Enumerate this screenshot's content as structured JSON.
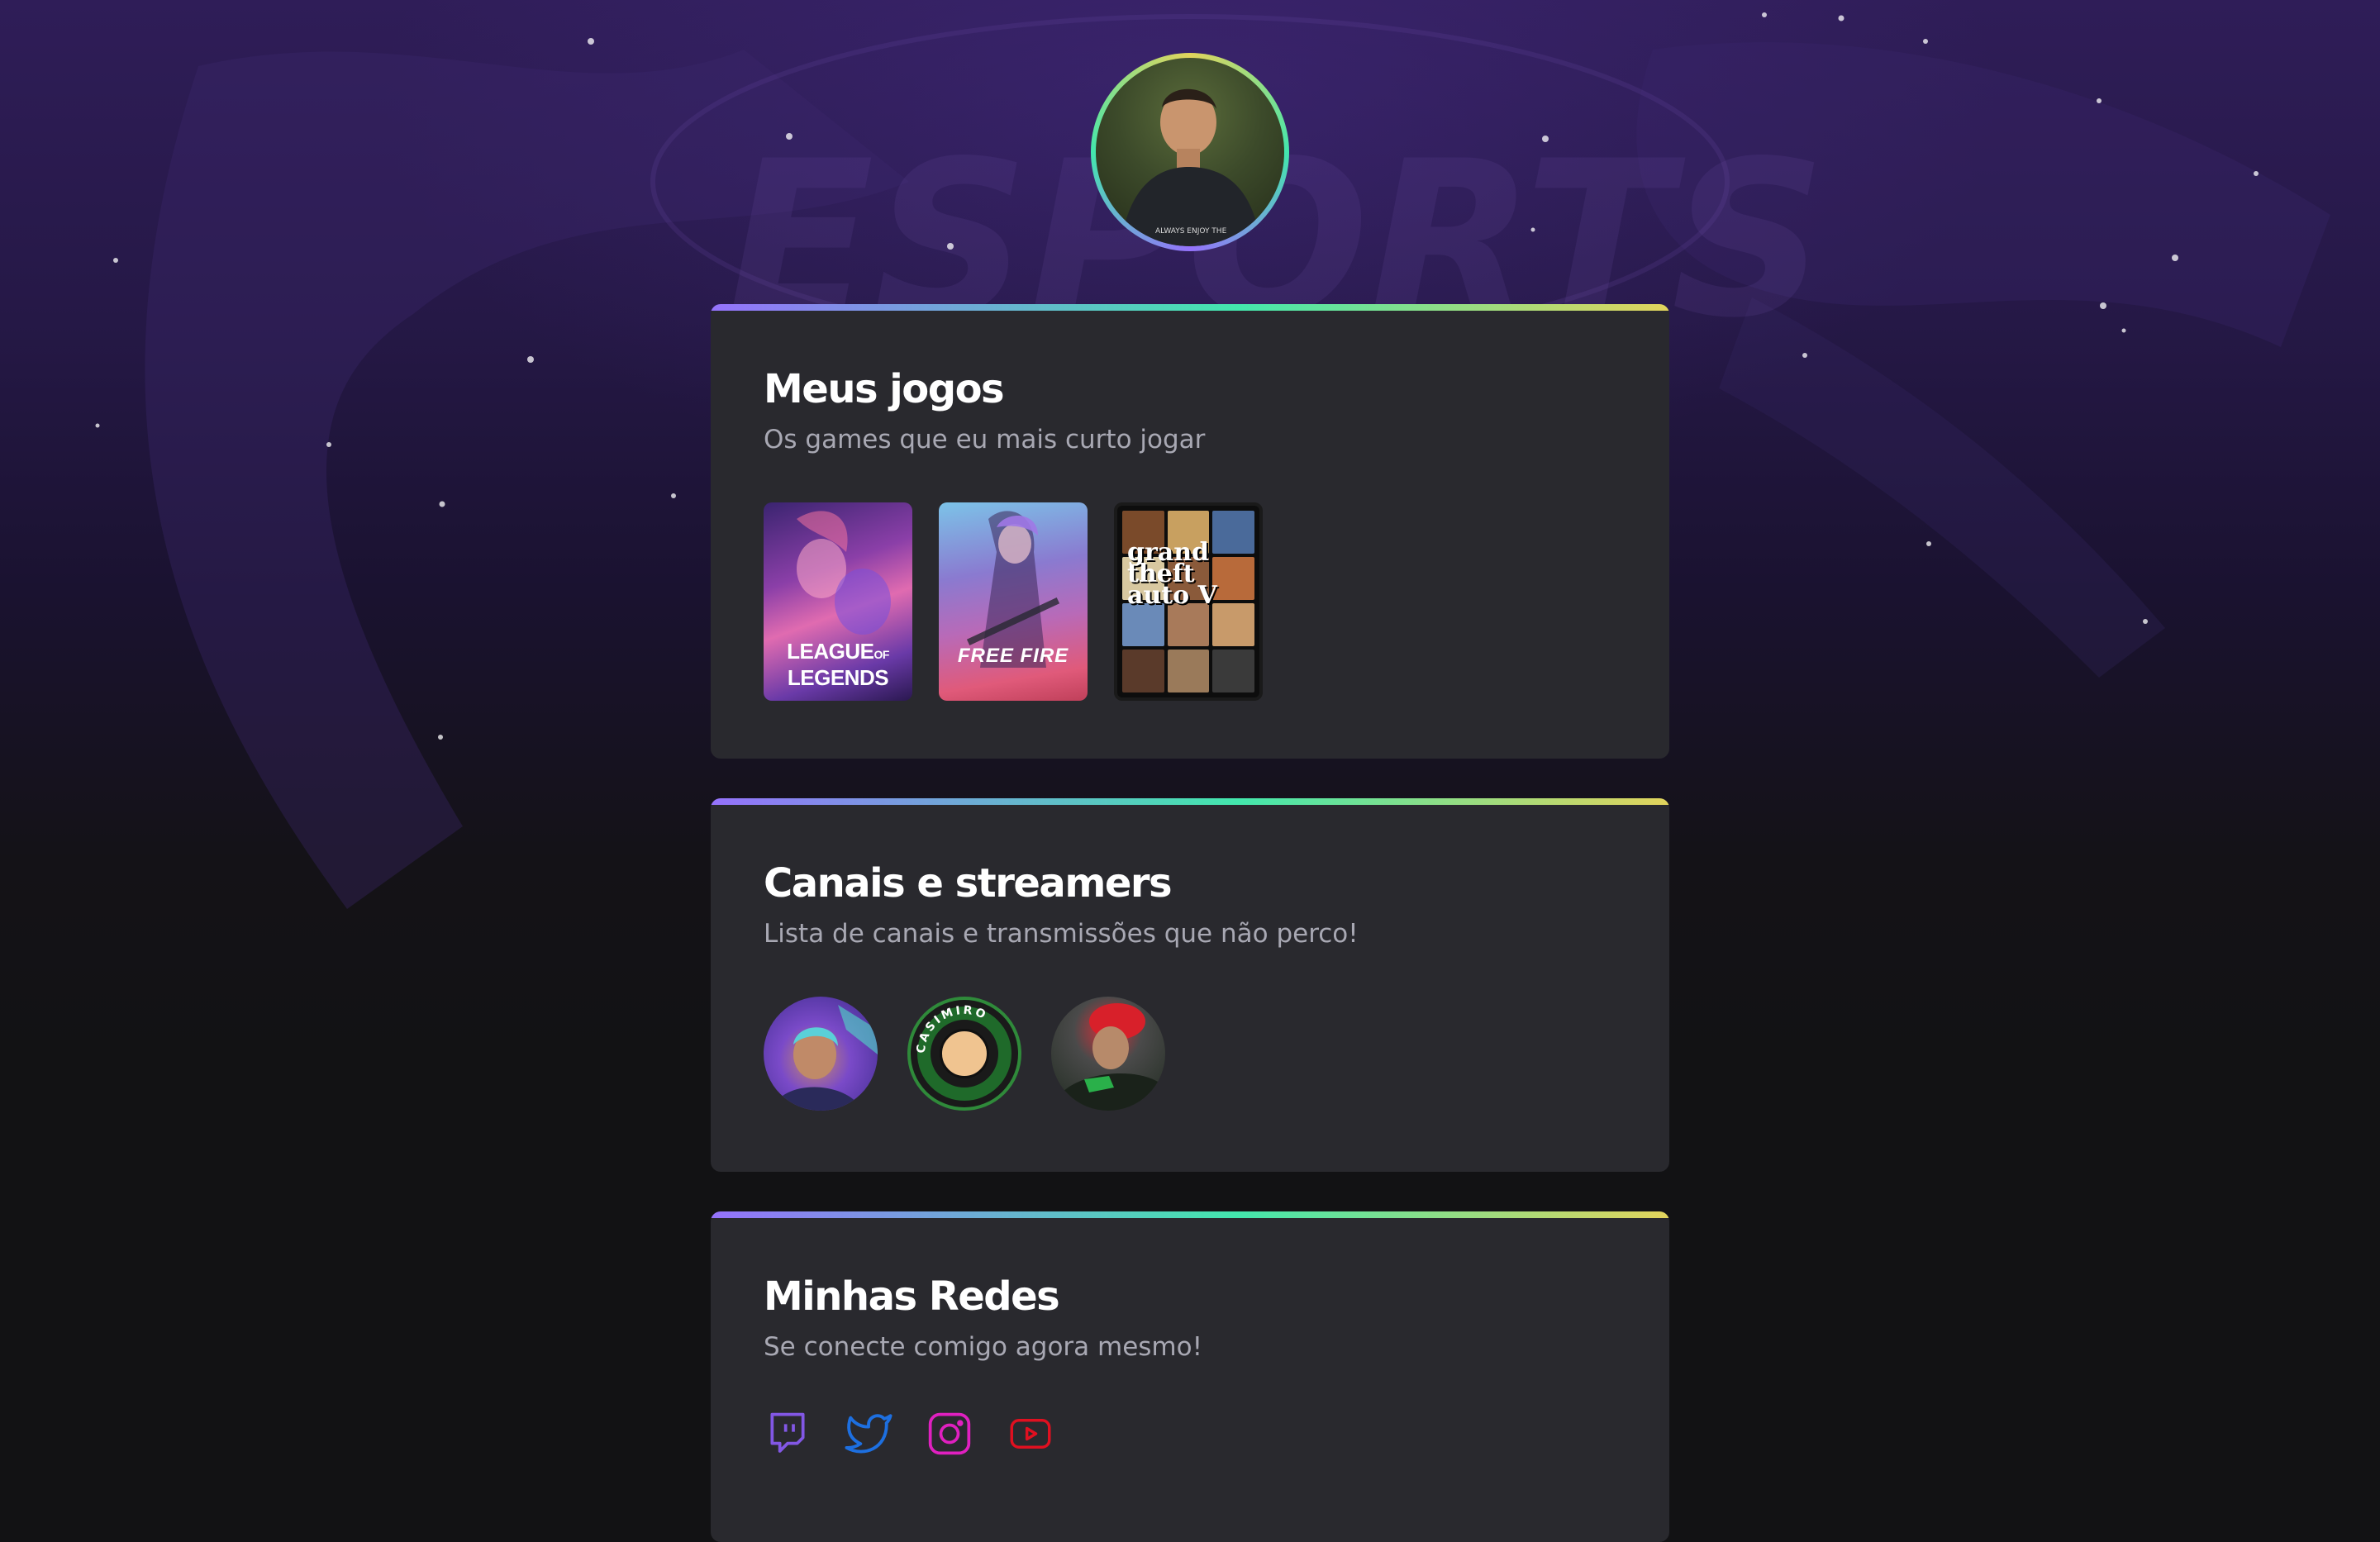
{
  "profile": {
    "avatar_alt": "Foto de perfil",
    "shirt_text": "ALWAYS ENJOY THE"
  },
  "sections": {
    "games": {
      "title": "Meus jogos",
      "subtitle": "Os games que eu mais curto jogar",
      "items": [
        {
          "name": "League of Legends",
          "label_line1": "LEAGUE",
          "label_of": "OF",
          "label_line2": "LEGENDS"
        },
        {
          "name": "Free Fire",
          "label": "FREE FIRE"
        },
        {
          "name": "Grand Theft Auto V",
          "label": "grand theft auto V"
        }
      ]
    },
    "streamers": {
      "title": "Canais e streamers",
      "subtitle": "Lista de canais e transmissões que não perco!",
      "items": [
        {
          "name": "streamer-1"
        },
        {
          "name": "Casimiro",
          "badge_text": "CASIMIRO"
        },
        {
          "name": "streamer-3"
        }
      ]
    },
    "socials": {
      "title": "Minhas Redes",
      "subtitle": "Se conecte comigo agora mesmo!",
      "items": [
        {
          "name": "Twitch",
          "icon": "twitch-icon",
          "color": "#8257e5"
        },
        {
          "name": "Twitter",
          "icon": "twitter-icon",
          "color": "#1d6fe0"
        },
        {
          "name": "Instagram",
          "icon": "instagram-icon",
          "color": "#e020c0"
        },
        {
          "name": "YouTube",
          "icon": "youtube-icon",
          "color": "#e01020"
        }
      ]
    }
  },
  "theme": {
    "card_bg": "#29292e",
    "gradient": [
      "#9572fc",
      "#43e7ad",
      "#e2d45c"
    ],
    "title_color": "#ffffff",
    "subtitle_color": "#a8a8b3"
  }
}
